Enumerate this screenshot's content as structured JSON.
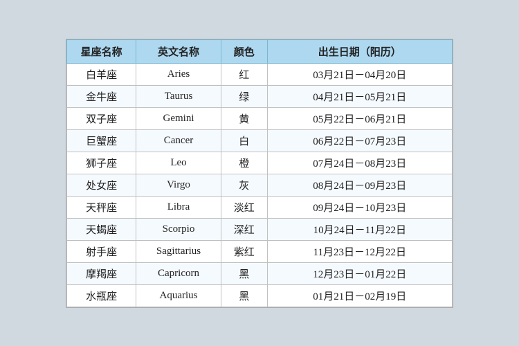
{
  "table": {
    "headers": {
      "zh_name": "星座名称",
      "en_name": "英文名称",
      "color": "颜色",
      "date": "出生日期（阳历）"
    },
    "rows": [
      {
        "zh": "白羊座",
        "en": "Aries",
        "color": "红",
        "date": "03月21日－04月20日"
      },
      {
        "zh": "金牛座",
        "en": "Taurus",
        "color": "绿",
        "date": "04月21日－05月21日"
      },
      {
        "zh": "双子座",
        "en": "Gemini",
        "color": "黄",
        "date": "05月22日－06月21日"
      },
      {
        "zh": "巨蟹座",
        "en": "Cancer",
        "color": "白",
        "date": "06月22日－07月23日"
      },
      {
        "zh": "狮子座",
        "en": "Leo",
        "color": "橙",
        "date": "07月24日－08月23日"
      },
      {
        "zh": "处女座",
        "en": "Virgo",
        "color": "灰",
        "date": "08月24日－09月23日"
      },
      {
        "zh": "天秤座",
        "en": "Libra",
        "color": "淡红",
        "date": "09月24日－10月23日"
      },
      {
        "zh": "天蝎座",
        "en": "Scorpio",
        "color": "深红",
        "date": "10月24日－11月22日"
      },
      {
        "zh": "射手座",
        "en": "Sagittarius",
        "color": "紫红",
        "date": "11月23日－12月22日"
      },
      {
        "zh": "摩羯座",
        "en": "Capricorn",
        "color": "黑",
        "date": "12月23日－01月22日"
      },
      {
        "zh": "水瓶座",
        "en": "Aquarius",
        "color": "黑",
        "date": "01月21日－02月19日"
      }
    ]
  }
}
